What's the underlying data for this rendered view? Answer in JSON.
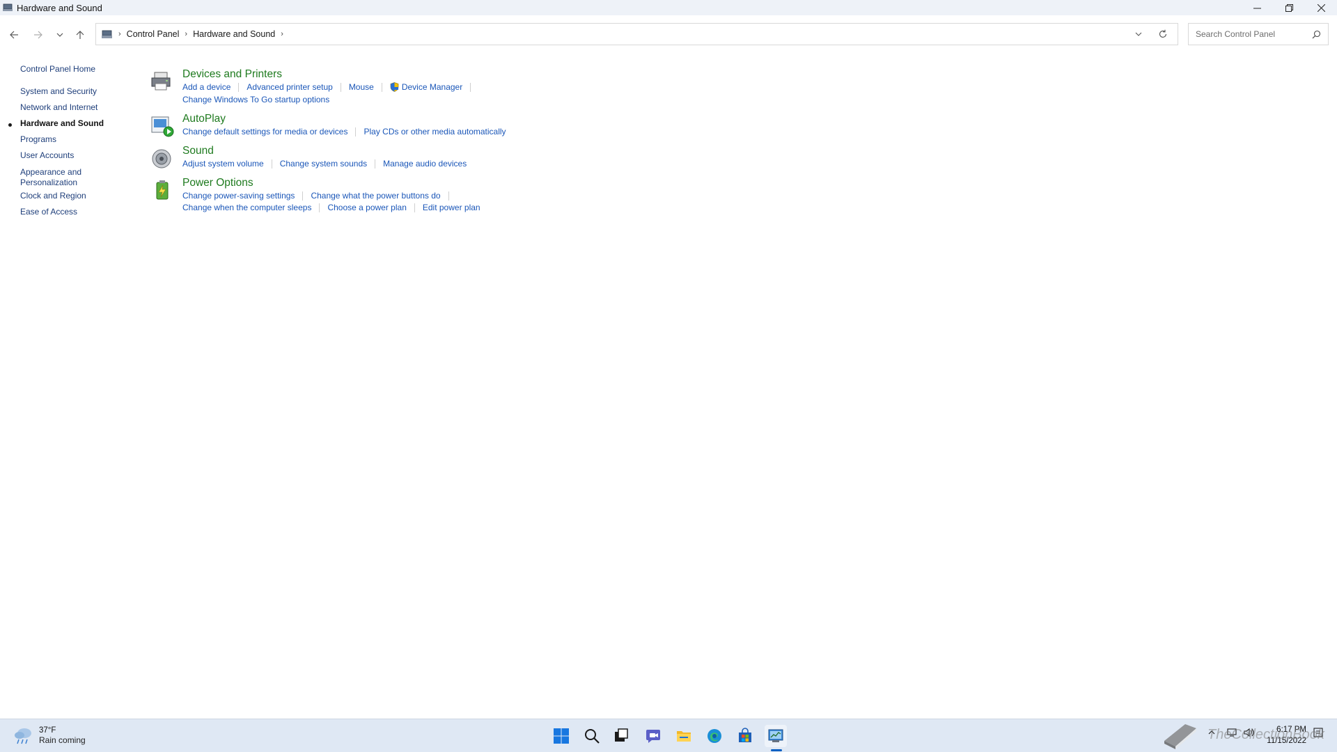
{
  "window": {
    "title": "Hardware and Sound"
  },
  "addressbar": {
    "crumbs": [
      "Control Panel",
      "Hardware and Sound"
    ],
    "sep": "›"
  },
  "search": {
    "placeholder": "Search Control Panel"
  },
  "leftnav": {
    "items": [
      {
        "label": "Control Panel Home"
      },
      {
        "label": "System and Security"
      },
      {
        "label": "Network and Internet"
      },
      {
        "label": "Hardware and Sound"
      },
      {
        "label": "Programs"
      },
      {
        "label": "User Accounts"
      },
      {
        "label": "Appearance and Personalization"
      },
      {
        "label": "Clock and Region"
      },
      {
        "label": "Ease of Access"
      }
    ]
  },
  "sections": [
    {
      "heading": "Devices and Printers",
      "rows": [
        [
          "Add a device",
          "Advanced printer setup",
          "Mouse",
          "Device Manager"
        ],
        [
          "Change Windows To Go startup options"
        ]
      ]
    },
    {
      "heading": "AutoPlay",
      "rows": [
        [
          "Change default settings for media or devices",
          "Play CDs or other media automatically"
        ]
      ]
    },
    {
      "heading": "Sound",
      "rows": [
        [
          "Adjust system volume",
          "Change system sounds",
          "Manage audio devices"
        ]
      ]
    },
    {
      "heading": "Power Options",
      "rows": [
        [
          "Change power-saving settings",
          "Change what the power buttons do"
        ],
        [
          "Change when the computer sleeps",
          "Choose a power plan",
          "Edit power plan"
        ]
      ]
    }
  ],
  "taskbar": {
    "weather_temp": "37°F",
    "weather_condition": "Rain coming",
    "time": "6:17 PM",
    "date": "11/15/2022",
    "watermark": "TheCollectionBook"
  },
  "colors": {
    "heading_green": "#1e7a1e",
    "link_blue": "#1a56b8",
    "nav_blue": "#1e3e7a",
    "taskbar_bg": "#dfe8f4"
  }
}
